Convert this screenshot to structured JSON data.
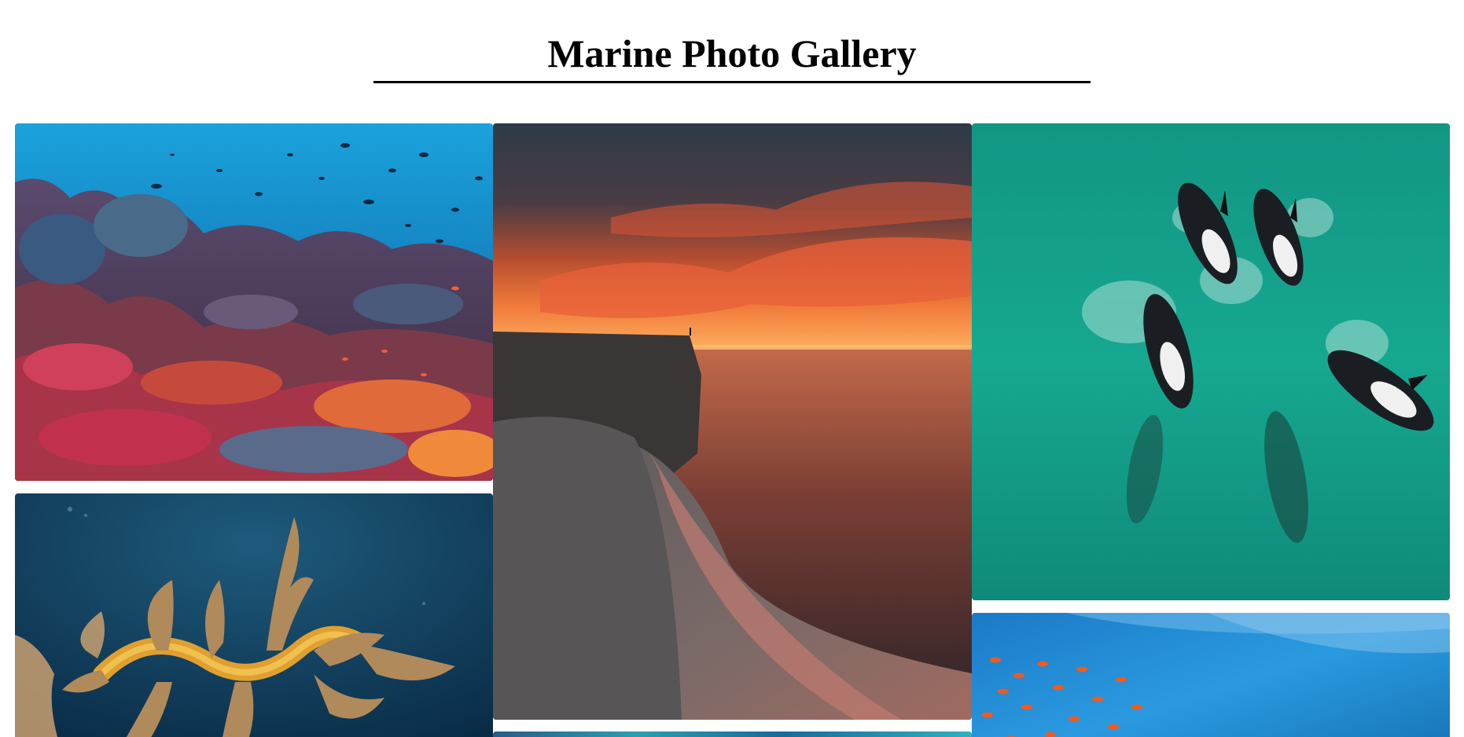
{
  "page": {
    "title": "Marine Photo Gallery"
  },
  "gallery": {
    "photos": [
      {
        "subject": "coral-reef-with-fish-school"
      },
      {
        "subject": "sunset-sea-cliff"
      },
      {
        "subject": "orcas-swimming-aerial"
      },
      {
        "subject": "leafy-sea-dragon"
      },
      {
        "subject": "orange-fish-school-underwater"
      },
      {
        "subject": "blue-teal-abstract"
      }
    ]
  },
  "colors": {
    "background": "#ffffff",
    "title": "#000000",
    "rule": "#000000"
  }
}
